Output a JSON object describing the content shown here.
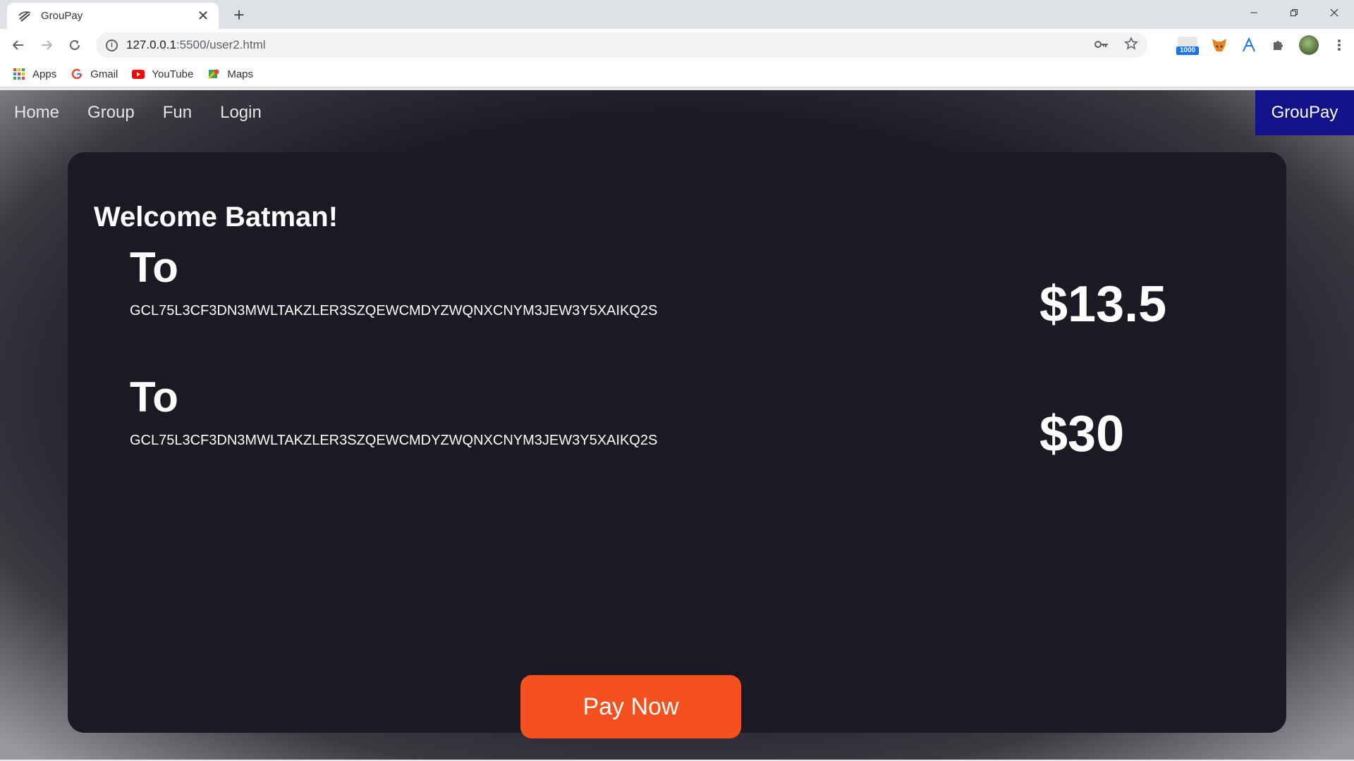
{
  "browser": {
    "tab": {
      "title": "GrouPay",
      "favicon": "groupay-logo-icon"
    },
    "url": {
      "host": "127.0.0.1",
      "path": ":5500/user2.html"
    },
    "extensions": {
      "badge_count": "1000"
    },
    "bookmarks": [
      {
        "label": "Apps",
        "icon": "apps-grid-icon"
      },
      {
        "label": "Gmail",
        "icon": "google-icon"
      },
      {
        "label": "YouTube",
        "icon": "youtube-icon"
      },
      {
        "label": "Maps",
        "icon": "maps-icon"
      }
    ]
  },
  "nav": {
    "links": [
      "Home",
      "Group",
      "Fun",
      "Login"
    ],
    "brand": "GrouPay"
  },
  "card": {
    "welcome": "Welcome Batman!",
    "payments": [
      {
        "label": "To",
        "address": "GCL75L3CF3DN3MWLTAKZLER3SZQEWCMDYZWQNXCNYM3JEW3Y5XAIKQ2S",
        "amount": "$13.5"
      },
      {
        "label": "To",
        "address": "GCL75L3CF3DN3MWLTAKZLER3SZQEWCMDYZWQNXCNYM3JEW3Y5XAIKQ2S",
        "amount": "$30"
      }
    ],
    "pay_button": "Pay Now"
  },
  "colors": {
    "card_bg": "#1b1923",
    "brand_bg": "#12128a",
    "pay_button": "#f4511e"
  }
}
